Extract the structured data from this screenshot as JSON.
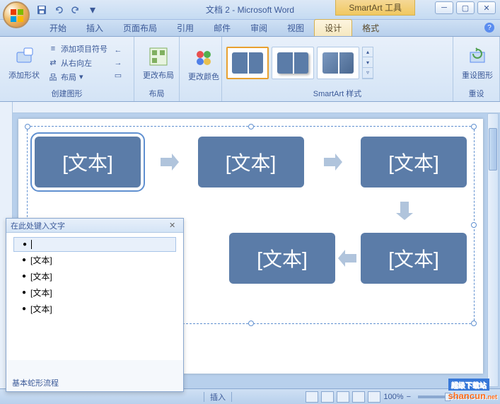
{
  "title": "文档 2 - Microsoft Word",
  "context_tool": "SmartArt 工具",
  "tabs": [
    "开始",
    "插入",
    "页面布局",
    "引用",
    "邮件",
    "审阅",
    "视图",
    "设计",
    "格式"
  ],
  "active_tab": 7,
  "ribbon": {
    "g1": {
      "label": "创建图形",
      "add_shape": "添加形状",
      "bullets": "添加项目符号",
      "rtl": "从右向左",
      "layout": "布局"
    },
    "g2": {
      "label": "布局",
      "change_layout": "更改布局"
    },
    "g3": {
      "change_colors": "更改颜色"
    },
    "g4": {
      "label": "SmartArt 样式"
    },
    "g5": {
      "label": "重设",
      "reset": "重设图形"
    }
  },
  "smartart": {
    "boxes": [
      "[文本]",
      "[文本]",
      "[文本]",
      "[文本]",
      "[文本]"
    ]
  },
  "textpane": {
    "title": "在此处键入文字",
    "items": [
      "",
      "[文本]",
      "[文本]",
      "[文本]",
      "[文本]"
    ],
    "footer": "基本蛇形流程"
  },
  "status": {
    "mode": "插入",
    "zoom": "100%"
  },
  "watermark": {
    "top": "超级下载站",
    "main": "shancun",
    "suffix": ".net"
  }
}
